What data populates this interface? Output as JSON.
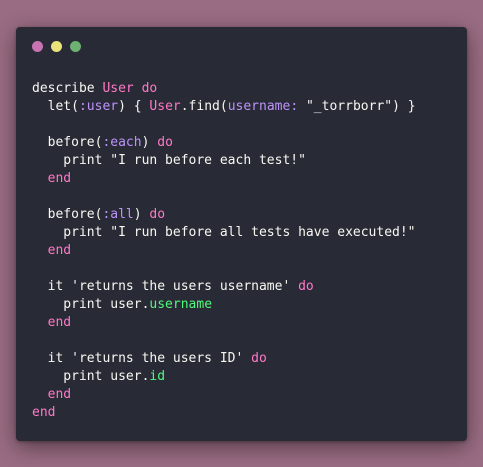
{
  "colors": {
    "background": "#9a6c83",
    "editor_background": "#282a36",
    "default_text": "#f8f8f2",
    "keyword": "#ff79c6",
    "symbol": "#bd93f9",
    "string": "#f1fa8c",
    "constant": "#8be9fd",
    "method": "#50fa7b"
  },
  "window_controls": [
    {
      "name": "close",
      "color": "#c773b3"
    },
    {
      "name": "minimize",
      "color": "#eae27a"
    },
    {
      "name": "maximize",
      "color": "#6fb173"
    }
  ],
  "code_lines": [
    [
      {
        "t": "describe ",
        "c": "default_text"
      },
      {
        "t": "User",
        "c": "keyword"
      },
      {
        "t": " ",
        "c": "default_text"
      },
      {
        "t": "do",
        "c": "keyword"
      }
    ],
    [
      {
        "t": "  let(",
        "c": "default_text"
      },
      {
        "t": ":user",
        "c": "symbol"
      },
      {
        "t": ") { ",
        "c": "default_text"
      },
      {
        "t": "User",
        "c": "keyword"
      },
      {
        "t": ".find(",
        "c": "default_text"
      },
      {
        "t": "username:",
        "c": "symbol"
      },
      {
        "t": " \"_torrborr\") }",
        "c": "default_text"
      }
    ],
    [],
    [
      {
        "t": "  before(",
        "c": "default_text"
      },
      {
        "t": ":each",
        "c": "symbol"
      },
      {
        "t": ") ",
        "c": "default_text"
      },
      {
        "t": "do",
        "c": "keyword"
      }
    ],
    [
      {
        "t": "    print \"I run before each test!\"",
        "c": "default_text"
      }
    ],
    [
      {
        "t": "  end",
        "c": "keyword"
      }
    ],
    [],
    [
      {
        "t": "  before(",
        "c": "default_text"
      },
      {
        "t": ":all",
        "c": "symbol"
      },
      {
        "t": ") ",
        "c": "default_text"
      },
      {
        "t": "do",
        "c": "keyword"
      }
    ],
    [
      {
        "t": "    print \"I run before all tests have executed!\"",
        "c": "default_text"
      }
    ],
    [
      {
        "t": "  end",
        "c": "keyword"
      }
    ],
    [],
    [
      {
        "t": "  it 'returns the users username' ",
        "c": "default_text"
      },
      {
        "t": "do",
        "c": "keyword"
      }
    ],
    [
      {
        "t": "    print user.",
        "c": "default_text"
      },
      {
        "t": "username",
        "c": "method"
      }
    ],
    [
      {
        "t": "  end",
        "c": "keyword"
      }
    ],
    [],
    [
      {
        "t": "  it 'returns the users ID' ",
        "c": "default_text"
      },
      {
        "t": "do",
        "c": "keyword"
      }
    ],
    [
      {
        "t": "    print user.",
        "c": "default_text"
      },
      {
        "t": "id",
        "c": "method"
      }
    ],
    [
      {
        "t": "  end",
        "c": "keyword"
      }
    ],
    [
      {
        "t": "end",
        "c": "keyword"
      }
    ]
  ]
}
